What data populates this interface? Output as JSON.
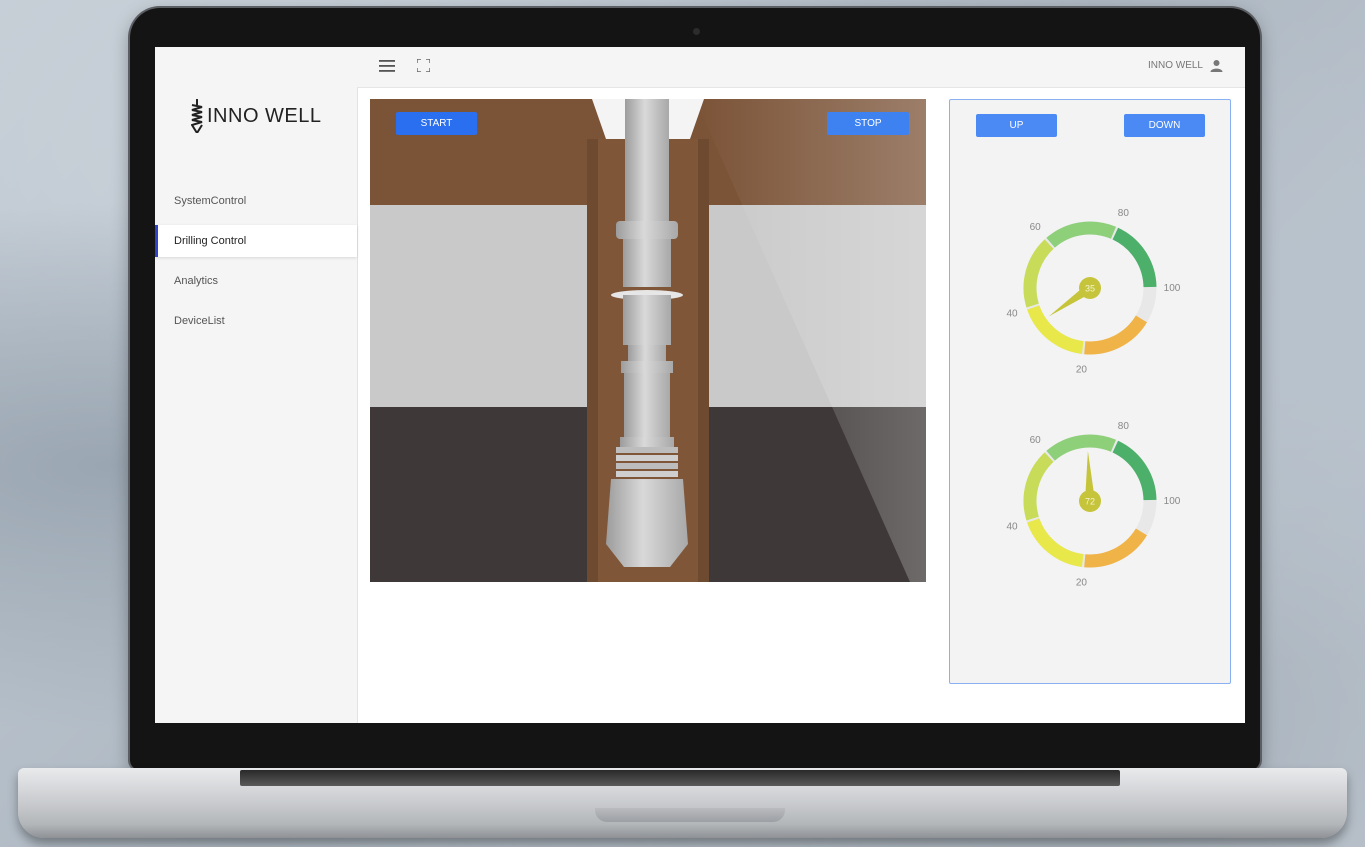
{
  "brand": {
    "name": "INNO WELL"
  },
  "topbar": {
    "user_name": "INNO WELL",
    "menu_icon": "menu-icon",
    "fullscreen_icon": "fullscreen-icon",
    "user_icon": "user-icon"
  },
  "sidebar": {
    "items": [
      {
        "label": "SystemControl",
        "active": false
      },
      {
        "label": "Drilling Control",
        "active": true
      },
      {
        "label": "Analytics",
        "active": false
      },
      {
        "label": "DeviceList",
        "active": false
      }
    ]
  },
  "controls": {
    "start_label": "START",
    "stop_label": "STOP",
    "up_label": "UP",
    "down_label": "DOWN"
  },
  "gauges": [
    {
      "value": 35,
      "value_label": "35",
      "ticks": [
        {
          "value": 20,
          "label": "20"
        },
        {
          "value": 40,
          "label": "40"
        },
        {
          "value": 60,
          "label": "60"
        },
        {
          "value": 80,
          "label": "80"
        },
        {
          "value": 100,
          "label": "100"
        }
      ]
    },
    {
      "value": 72,
      "value_label": "72",
      "ticks": [
        {
          "value": 20,
          "label": "20"
        },
        {
          "value": 40,
          "label": "40"
        },
        {
          "value": 60,
          "label": "60"
        },
        {
          "value": 80,
          "label": "80"
        },
        {
          "value": 100,
          "label": "100"
        }
      ]
    }
  ],
  "colors": {
    "accent": "#2f44c8",
    "button_blue": "#2a6ff0",
    "gauge_green_dark": "#4caf6a",
    "gauge_green": "#8ed07a",
    "gauge_yellow": "#e8e84a",
    "gauge_orange": "#f0b347",
    "gauge_lime": "#c8dc5a"
  }
}
